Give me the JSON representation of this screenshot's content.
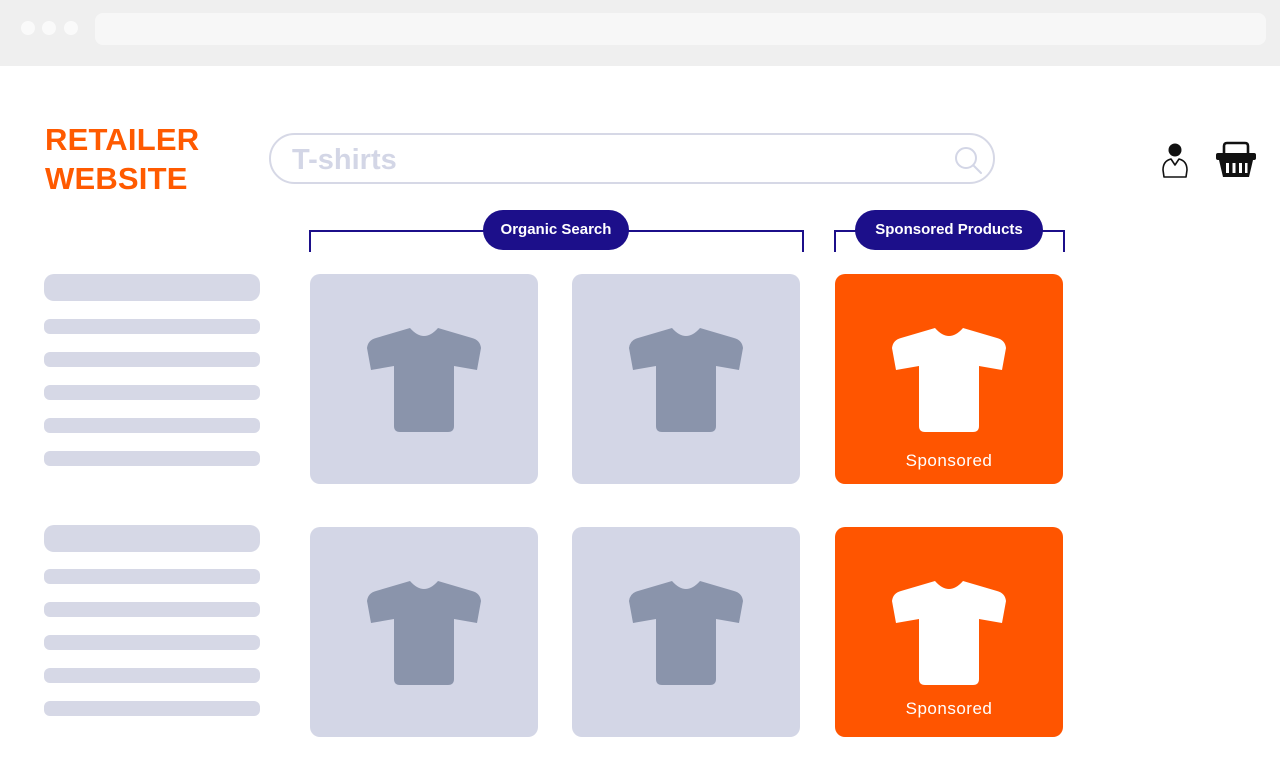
{
  "browser": {
    "window_controls": [
      "close",
      "minimize",
      "maximize"
    ]
  },
  "header": {
    "logo_line1": "RETAILER",
    "logo_line2": "WEBSITE",
    "search_value": "T-shirts",
    "icons": [
      "search-icon",
      "account-icon",
      "basket-icon"
    ]
  },
  "sections": {
    "organic_label": "Organic Search",
    "sponsored_label": "Sponsored Products"
  },
  "products": {
    "row1": [
      {
        "type": "organic",
        "icon": "tshirt-icon"
      },
      {
        "type": "organic",
        "icon": "tshirt-icon"
      },
      {
        "type": "sponsored",
        "icon": "tshirt-icon",
        "label": "Sponsored"
      }
    ],
    "row2": [
      {
        "type": "organic",
        "icon": "tshirt-icon"
      },
      {
        "type": "organic",
        "icon": "tshirt-icon"
      },
      {
        "type": "sponsored",
        "icon": "tshirt-icon",
        "label": "Sponsored"
      }
    ]
  },
  "colors": {
    "brand": "#ff5a00",
    "sponsored_card": "#ff5500",
    "label_pill": "#1c0f8a",
    "placeholder_gray": "#d3d6e6",
    "organic_shirt": "#8a94ab"
  }
}
